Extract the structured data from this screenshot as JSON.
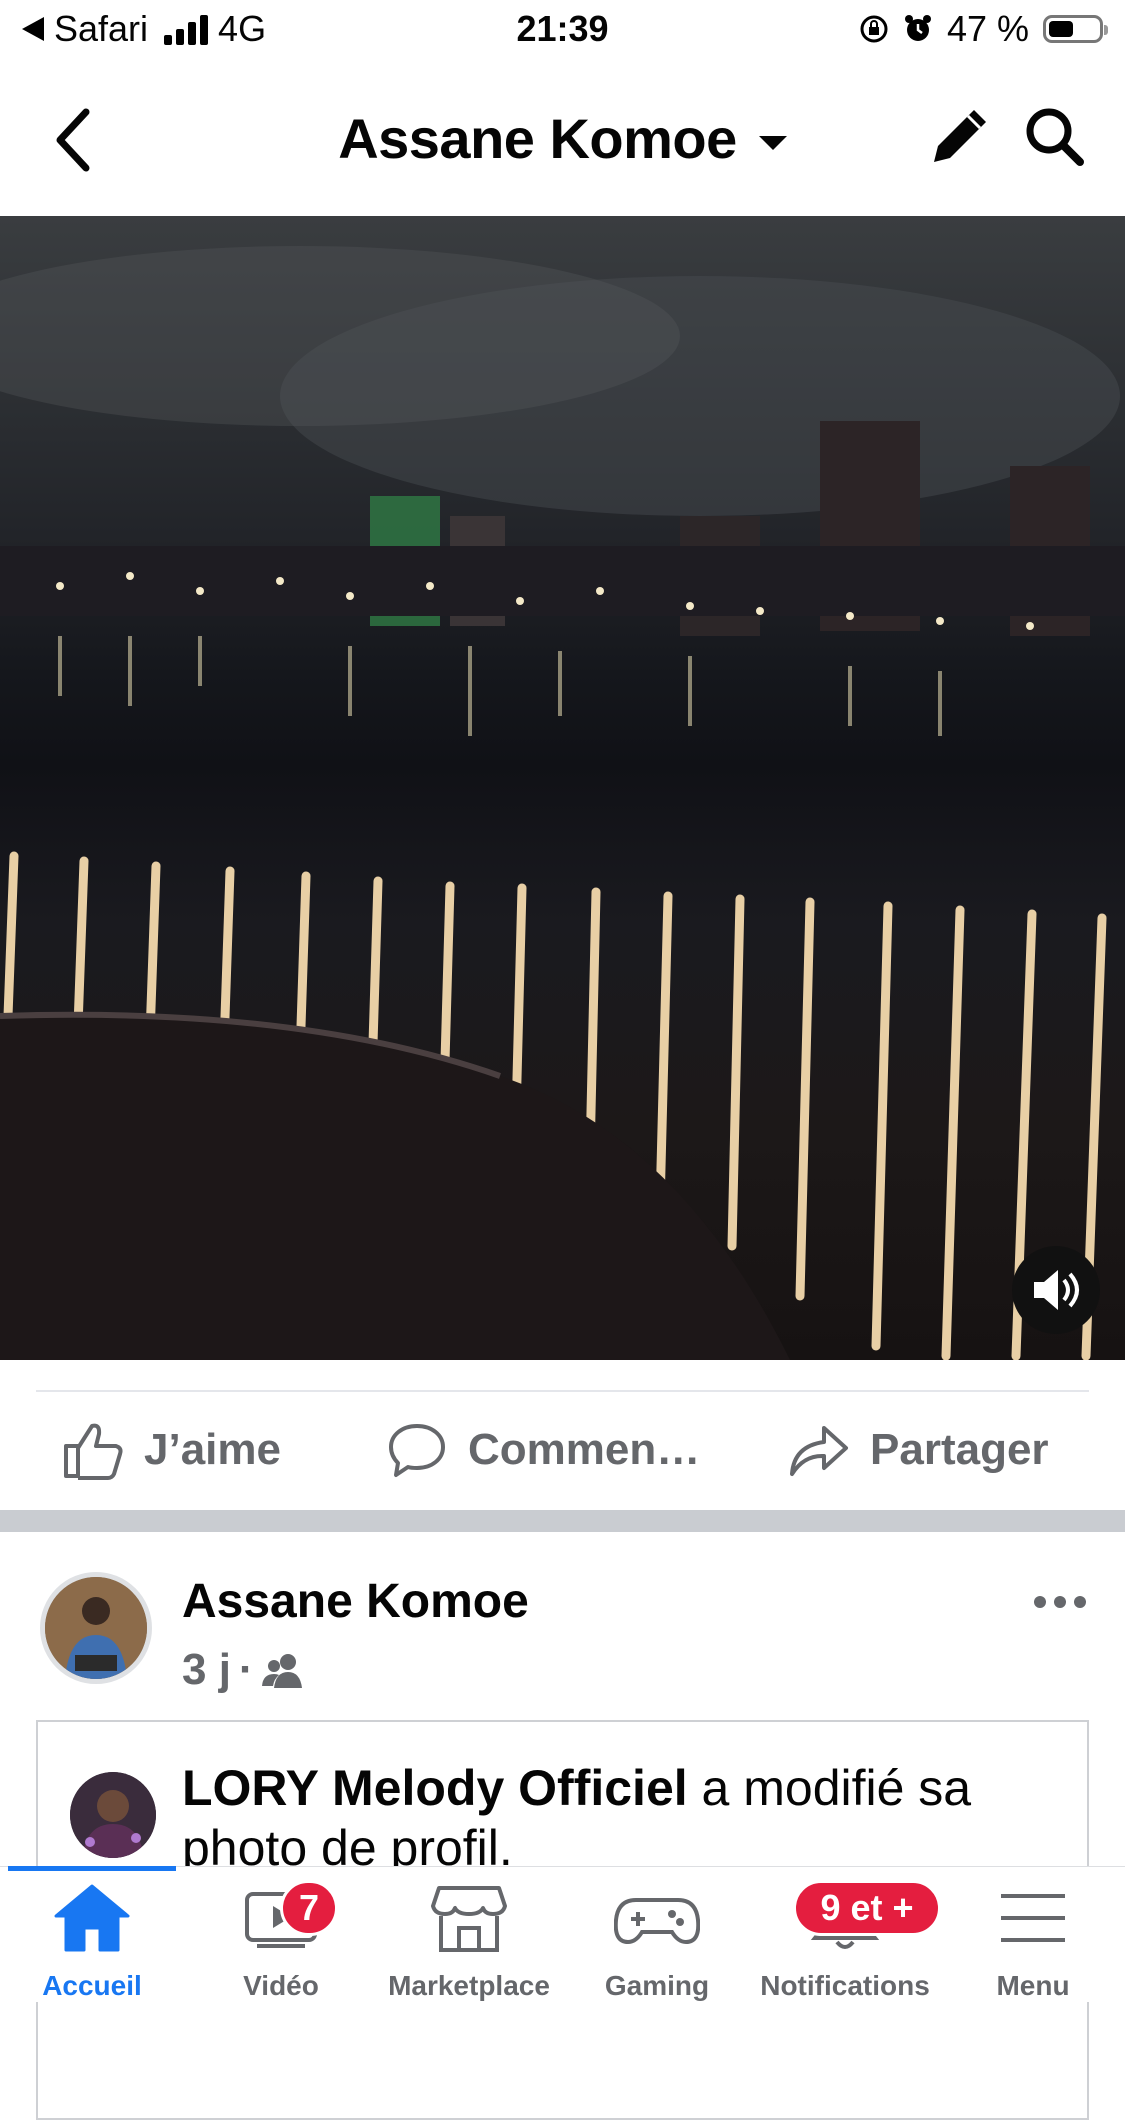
{
  "status_bar": {
    "back_app": "Safari",
    "network": "4G",
    "time": "21:39",
    "battery": "47 %"
  },
  "header": {
    "title": "Assane Komoe",
    "title_icon": "chevron-down-icon",
    "actions": [
      "edit-icon",
      "search-icon"
    ]
  },
  "video": {
    "sound_icon": "speaker-icon"
  },
  "post_actions": {
    "like": "J’aime",
    "comment": "Commen…",
    "share": "Partager"
  },
  "post": {
    "author": "Assane Komoe",
    "time": "3 j",
    "audience_icon": "friends-icon",
    "shared": {
      "name": "LORY Melody Officiel",
      "text": " a modifié sa photo de profil."
    }
  },
  "tabbar": {
    "accent": "#1877f2",
    "badge_color": "#e41e3f",
    "tabs": [
      {
        "label": "Accueil",
        "icon": "home-icon",
        "active": true
      },
      {
        "label": "Vidéo",
        "icon": "video-icon",
        "badge": "7"
      },
      {
        "label": "Marketplace",
        "icon": "shop-icon"
      },
      {
        "label": "Gaming",
        "icon": "gamepad-icon"
      },
      {
        "label": "Notifications",
        "icon": "bell-icon",
        "badge": "9 et +"
      },
      {
        "label": "Menu",
        "icon": "menu-icon"
      }
    ]
  }
}
